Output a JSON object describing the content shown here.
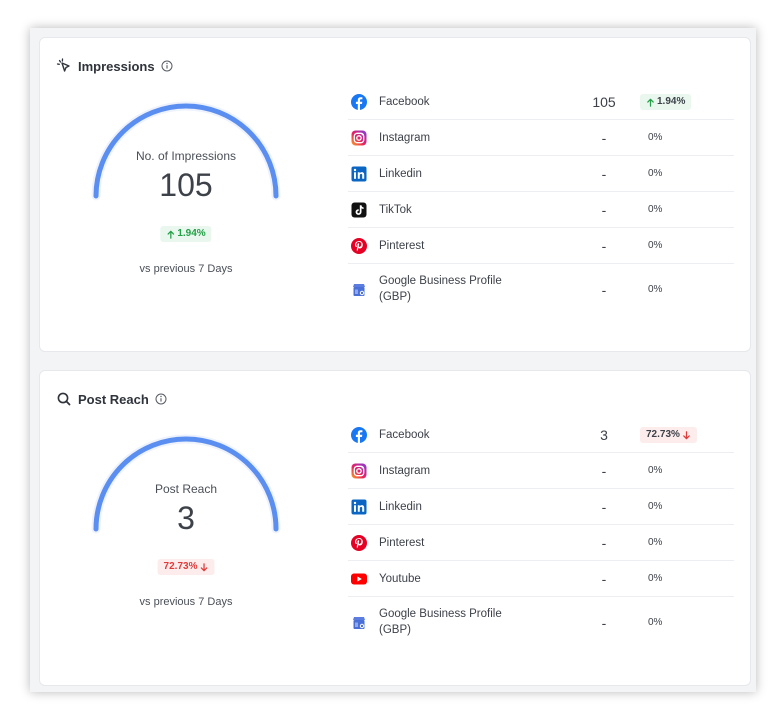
{
  "colors": {
    "gauge": "#5b8ef1",
    "up": "#23a046",
    "down": "#e03b3b",
    "facebook": "#1877f2",
    "linkedin": "#0a66c2",
    "pinterest": "#e60023",
    "youtube": "#ff0000",
    "tiktok": "#111111",
    "gbp": "#4a6fd6"
  },
  "impressions": {
    "title": "Impressions",
    "gauge_label": "No. of Impressions",
    "gauge_value": "105",
    "change": "1.94%",
    "change_direction": "up",
    "comparison": "vs previous 7 Days",
    "platforms": [
      {
        "name": "Facebook",
        "icon": "facebook-icon",
        "value": "105",
        "change": "1.94%",
        "direction": "up"
      },
      {
        "name": "Instagram",
        "icon": "instagram-icon",
        "value": "-",
        "change": "0%"
      },
      {
        "name": "Linkedin",
        "icon": "linkedin-icon",
        "value": "-",
        "change": "0%"
      },
      {
        "name": "TikTok",
        "icon": "tiktok-icon",
        "value": "-",
        "change": "0%"
      },
      {
        "name": "Pinterest",
        "icon": "pinterest-icon",
        "value": "-",
        "change": "0%"
      },
      {
        "name": "Google Business Profile (GBP)",
        "icon": "google-business-icon",
        "value": "-",
        "change": "0%"
      }
    ]
  },
  "post_reach": {
    "title": "Post Reach",
    "gauge_label": "Post Reach",
    "gauge_value": "3",
    "change": "72.73%",
    "change_direction": "down",
    "comparison": "vs previous 7 Days",
    "platforms": [
      {
        "name": "Facebook",
        "icon": "facebook-icon",
        "value": "3",
        "change": "72.73%",
        "direction": "down"
      },
      {
        "name": "Instagram",
        "icon": "instagram-icon",
        "value": "-",
        "change": "0%"
      },
      {
        "name": "Linkedin",
        "icon": "linkedin-icon",
        "value": "-",
        "change": "0%"
      },
      {
        "name": "Pinterest",
        "icon": "pinterest-icon",
        "value": "-",
        "change": "0%"
      },
      {
        "name": "Youtube",
        "icon": "youtube-icon",
        "value": "-",
        "change": "0%"
      },
      {
        "name": "Google Business Profile (GBP)",
        "icon": "google-business-icon",
        "value": "-",
        "change": "0%"
      }
    ]
  }
}
